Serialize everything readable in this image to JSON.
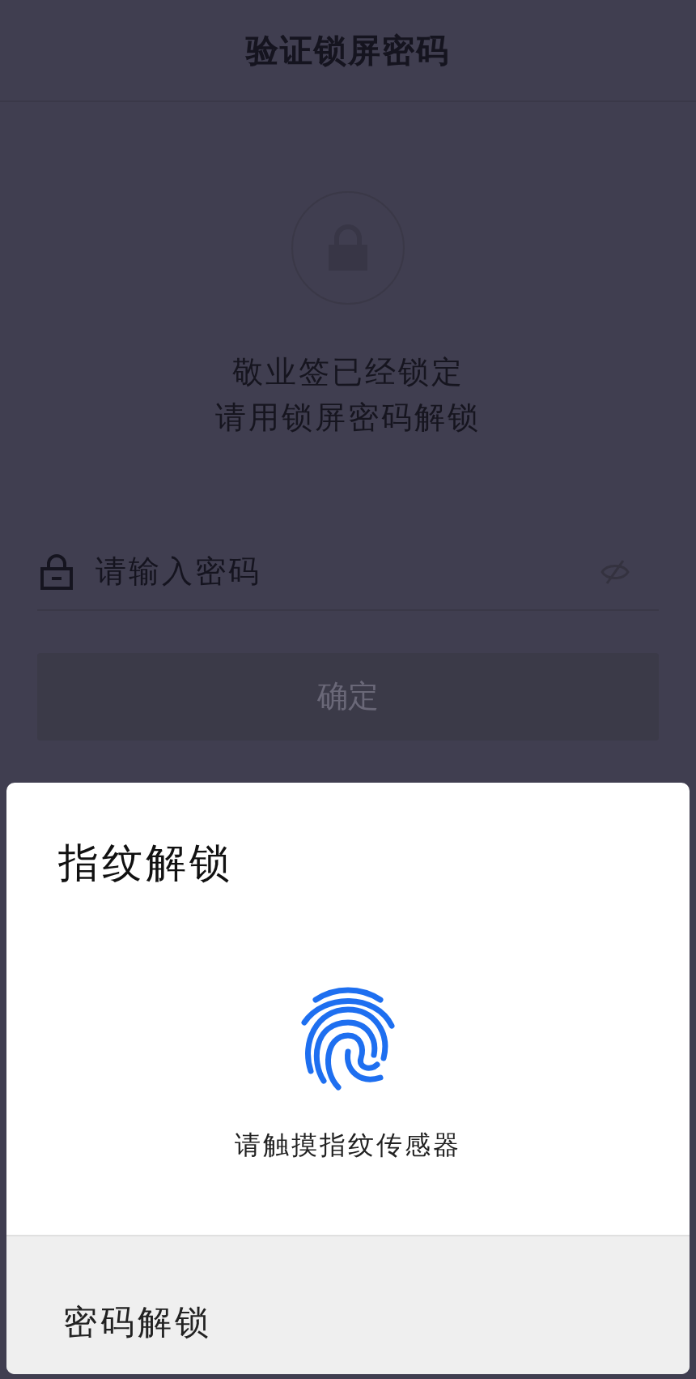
{
  "header": {
    "title": "验证锁屏密码"
  },
  "lock_message": [
    "敬业签已经锁定",
    "请用锁屏密码解锁"
  ],
  "password_field": {
    "placeholder": "请输入密码"
  },
  "confirm_button": {
    "label": "确定",
    "disabled": true
  },
  "fingerprint_sheet": {
    "title": "指纹解锁",
    "hint": "请触摸指纹传感器",
    "alternative": "密码解锁"
  }
}
